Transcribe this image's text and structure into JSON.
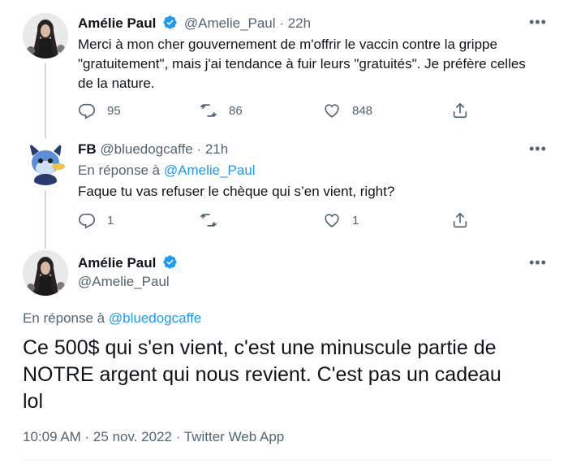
{
  "tweets": [
    {
      "display_name": "Amélie Paul",
      "handle": "@Amelie_Paul",
      "time": "22h",
      "text_lines": [
        "Merci à mon cher gouvernement de m'offrir le vaccin contre la grippe",
        "\"gratuitement\", mais j'ai tendance à fuir leurs \"gratuités\". Je préfère celles",
        "de la nature."
      ],
      "reply_count": "95",
      "retweet_count": "86",
      "like_count": "848"
    },
    {
      "display_name": "FB",
      "handle": "@bluedogcaffe",
      "time": "21h",
      "reply_prefix": "En réponse à",
      "reply_to": "@Amelie_Paul",
      "text": "Faque tu vas refuser le chèque qui s’en vient, right?",
      "reply_count": "1",
      "retweet_count": "",
      "like_count": "1"
    }
  ],
  "main_tweet": {
    "display_name": "Amélie Paul",
    "handle": "@Amelie_Paul",
    "reply_prefix": "En réponse à",
    "reply_to": "@bluedogcaffe",
    "text_lines": [
      "Ce 500$ qui s'en vient, c'est une minuscule partie de",
      "NOTRE argent qui nous revient. C'est pas un cadeau",
      "lol"
    ],
    "timestamp": "10:09 AM · 25 nov. 2022 · Twitter Web App"
  },
  "colors": {
    "text": "#0f1419",
    "secondary": "#536471",
    "accent": "#1d9bf0",
    "verified": "#1d9bf0",
    "thread_line": "#cfd9de"
  },
  "icons": [
    "verified-badge-icon",
    "more-icon",
    "reply-icon",
    "retweet-icon",
    "like-icon",
    "share-icon"
  ]
}
